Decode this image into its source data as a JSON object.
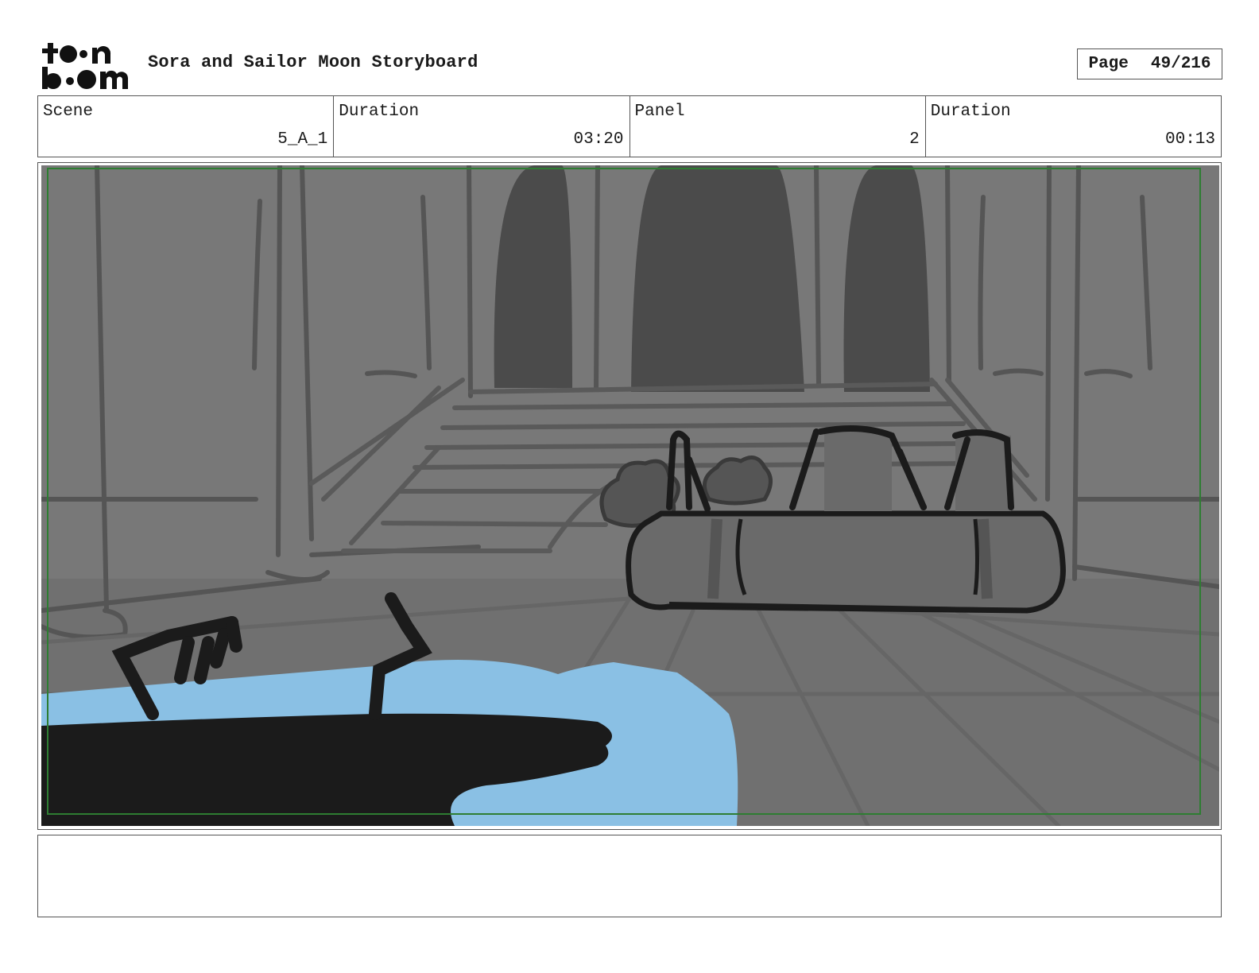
{
  "header": {
    "logo_text": "toonboom",
    "title": "Sora and Sailor Moon Storyboard",
    "page_label": "Page",
    "page_number": "49/216"
  },
  "info": {
    "scene_label": "Scene",
    "scene_value": "5_A_1",
    "scene_duration_label": "Duration",
    "scene_duration_value": "03:20",
    "panel_label": "Panel",
    "panel_value": "2",
    "panel_duration_label": "Duration",
    "panel_duration_value": "00:13"
  },
  "panel_image": {
    "colors": {
      "background": "#6f6f6f",
      "walls": "#7a7a7a",
      "doorways": "#4b4b4b",
      "lines": "#555555",
      "ink": "#1b1b1b",
      "water": "#8ac0e4",
      "safe_frame": "#2e7d32"
    }
  },
  "notes": {
    "text": ""
  }
}
